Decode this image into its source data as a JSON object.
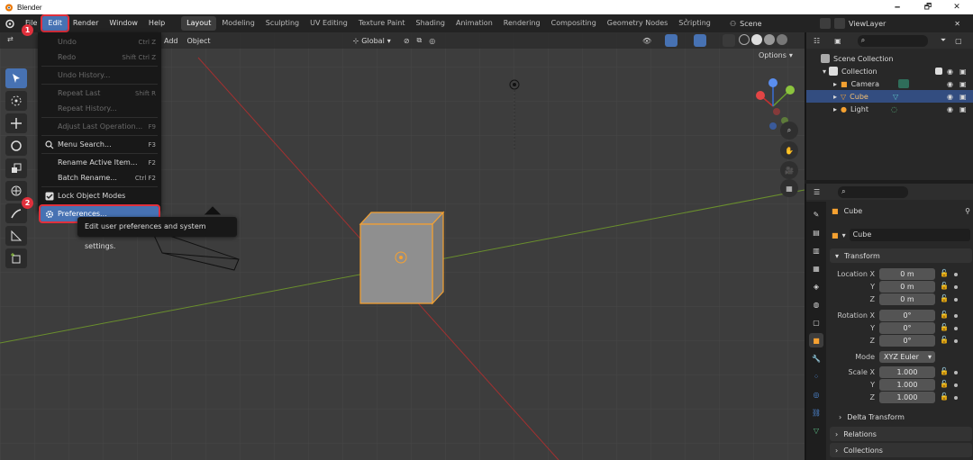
{
  "window": {
    "title": "Blender",
    "minimize": "🗕",
    "maximize": "🗗",
    "close": "✕"
  },
  "menubar": {
    "items": [
      "File",
      "Edit",
      "Render",
      "Window",
      "Help"
    ],
    "active": "Edit"
  },
  "workspaces": [
    "Layout",
    "Modeling",
    "Sculpting",
    "UV Editing",
    "Texture Paint",
    "Shading",
    "Animation",
    "Rendering",
    "Compositing",
    "Geometry Nodes",
    "Scripting"
  ],
  "scene": {
    "name": "Scene",
    "view_layer": "ViewLayer"
  },
  "viewport_header": {
    "add": "Add",
    "object": "Object",
    "orientation": "Global",
    "options": "Options"
  },
  "edit_menu": {
    "items": [
      {
        "label": "Undo",
        "shortcut": "Ctrl Z",
        "enabled": false
      },
      {
        "label": "Redo",
        "shortcut": "Shift Ctrl Z",
        "enabled": false
      },
      {
        "label": "Undo History...",
        "shortcut": "",
        "enabled": false
      },
      {
        "label": "Repeat Last",
        "shortcut": "Shift R",
        "enabled": false
      },
      {
        "label": "Repeat History...",
        "shortcut": "",
        "enabled": false
      },
      {
        "label": "Adjust Last Operation...",
        "shortcut": "F9",
        "enabled": false
      },
      {
        "label": "Menu Search...",
        "shortcut": "F3",
        "enabled": true
      },
      {
        "label": "Rename Active Item...",
        "shortcut": "F2",
        "enabled": true
      },
      {
        "label": "Batch Rename...",
        "shortcut": "Ctrl F2",
        "enabled": true
      },
      {
        "label": "Lock Object Modes",
        "shortcut": "",
        "enabled": true
      },
      {
        "label": "Preferences...",
        "shortcut": "",
        "enabled": true
      }
    ]
  },
  "tooltip": "Edit user preferences and system settings.",
  "annotations": {
    "step1": "1",
    "step2": "2"
  },
  "outliner": {
    "scene_collection": "Scene Collection",
    "collection": "Collection",
    "objects": [
      {
        "name": "Camera",
        "selected": false
      },
      {
        "name": "Cube",
        "selected": true
      },
      {
        "name": "Light",
        "selected": false
      }
    ]
  },
  "properties": {
    "object_name": "Cube",
    "datablock": "Cube",
    "transform_title": "Transform",
    "location_label": "Location X",
    "rotation_label": "Rotation X",
    "scale_label": "Scale X",
    "axis_y": "Y",
    "axis_z": "Z",
    "location": [
      "0 m",
      "0 m",
      "0 m"
    ],
    "rotation": [
      "0°",
      "0°",
      "0°"
    ],
    "mode_label": "Mode",
    "mode": "XYZ Euler",
    "scale": [
      "1.000",
      "1.000",
      "1.000"
    ],
    "delta_transform": "Delta Transform",
    "relations": "Relations",
    "collections": "Collections"
  },
  "colors": {
    "accent": "#4772b3",
    "annotation": "#e0303c",
    "selection": "#f5a131"
  }
}
